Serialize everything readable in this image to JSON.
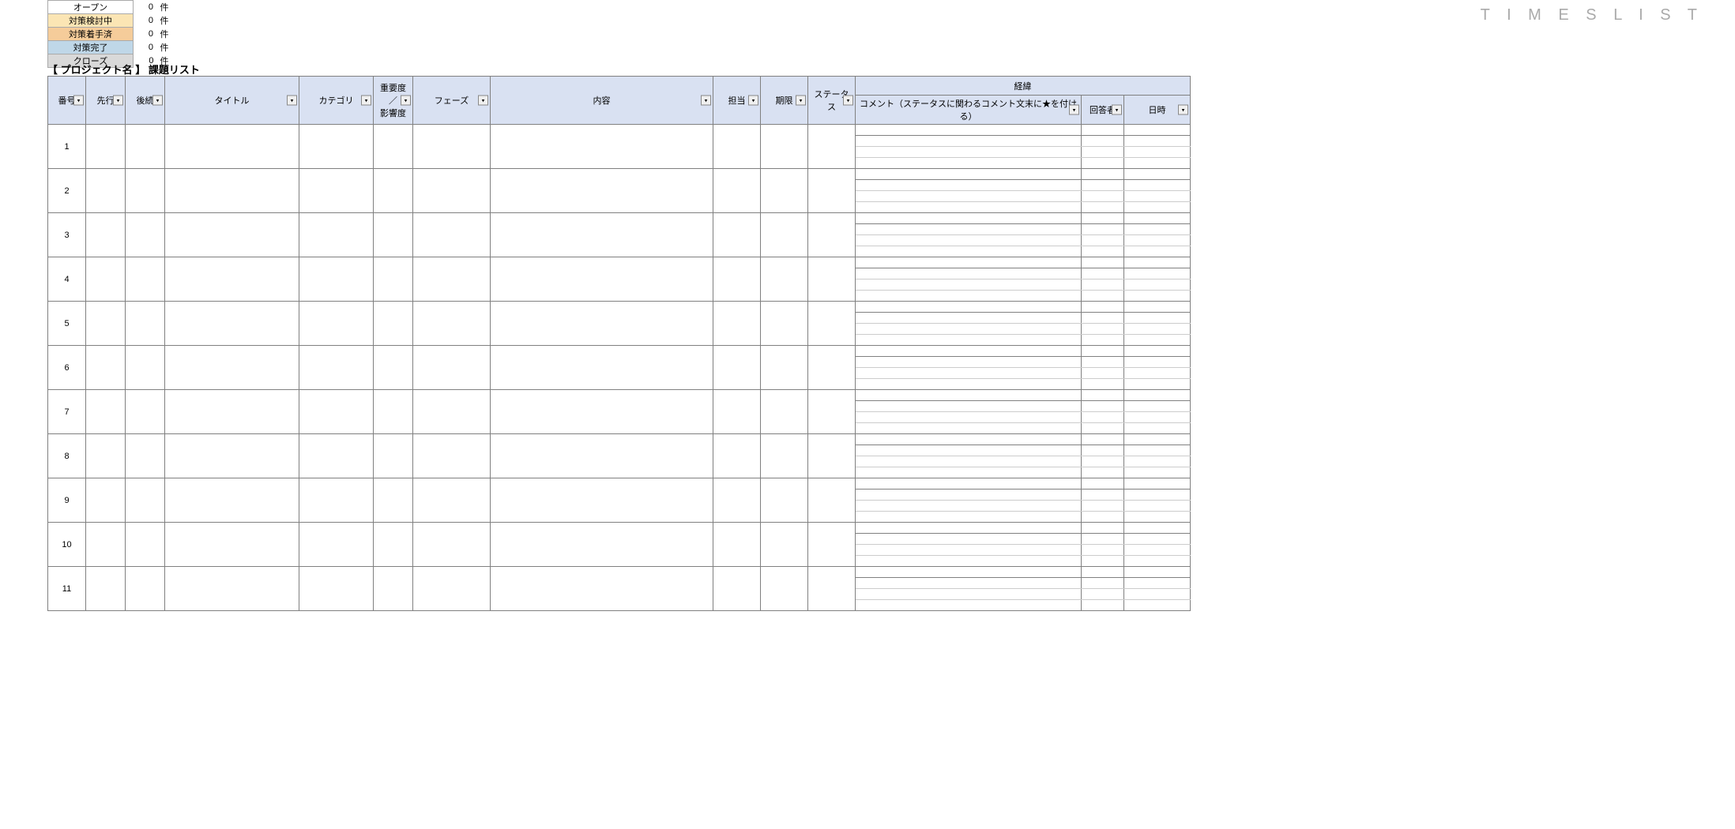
{
  "brand": "T I M E S L I S T",
  "status_summary": {
    "rows": [
      {
        "label": "オープン",
        "count": 0,
        "unit": "件",
        "class": "bg-open"
      },
      {
        "label": "対策検討中",
        "count": 0,
        "unit": "件",
        "class": "bg-kentochu"
      },
      {
        "label": "対策着手済",
        "count": 0,
        "unit": "件",
        "class": "bg-chakushu"
      },
      {
        "label": "対策完了",
        "count": 0,
        "unit": "件",
        "class": "bg-kanryo"
      },
      {
        "label": "クローズ",
        "count": 0,
        "unit": "件",
        "class": "bg-close"
      }
    ]
  },
  "title": "【 プロジェクト名 】 課題リスト",
  "columns": {
    "no": "番号",
    "pred": "先行",
    "succ": "後続",
    "title": "タイトル",
    "cat": "カテゴリ",
    "prio": "重要度／\n影響度",
    "phase": "フェーズ",
    "content": "内容",
    "owner": "担当",
    "due": "期限",
    "status": "ステータス",
    "history_group": "経緯",
    "comment": "コメント（ステータスに関わるコメント文末に★を付ける）",
    "responder": "回答者",
    "datetime": "日時"
  },
  "dropdown_glyph": "▾",
  "rows": [
    {
      "no": 1
    },
    {
      "no": 2
    },
    {
      "no": 3
    },
    {
      "no": 4
    },
    {
      "no": 5
    },
    {
      "no": 6
    },
    {
      "no": 7
    },
    {
      "no": 8
    },
    {
      "no": 9
    },
    {
      "no": 10
    },
    {
      "no": 11
    }
  ],
  "sublines_per_row": 4
}
